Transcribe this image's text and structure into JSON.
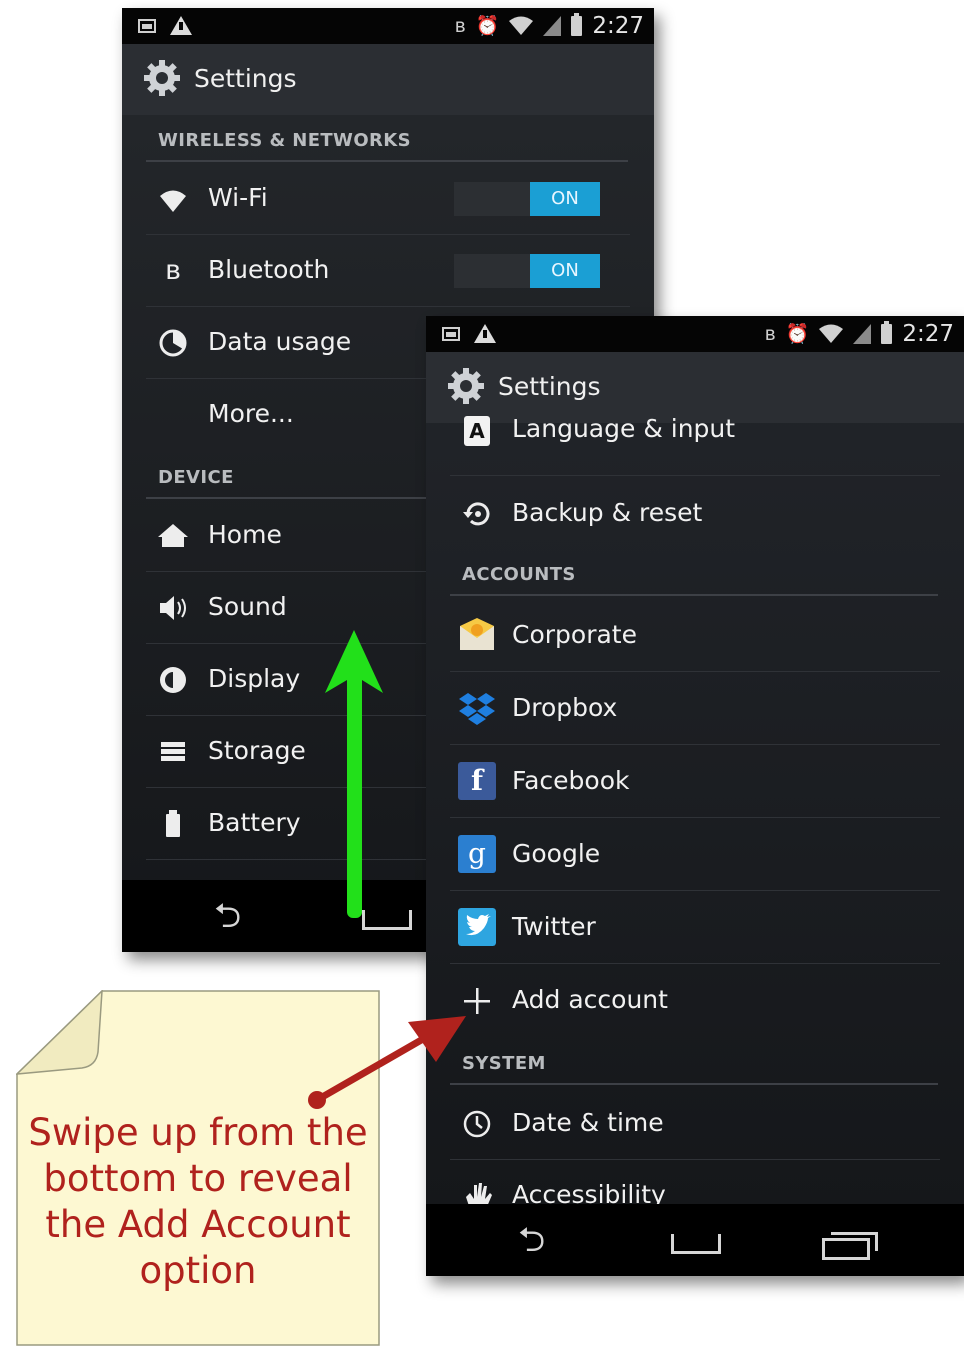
{
  "status": {
    "time": "2:27"
  },
  "back_screen": {
    "title": "Settings",
    "sections": {
      "wireless": "WIRELESS & NETWORKS",
      "device": "DEVICE"
    },
    "items": {
      "wifi": "Wi-Fi",
      "bluetooth": "Bluetooth",
      "data_usage": "Data usage",
      "more": "More...",
      "home": "Home",
      "sound": "Sound",
      "display": "Display",
      "storage": "Storage",
      "battery": "Battery"
    },
    "toggle_on": "ON"
  },
  "front_screen": {
    "title": "Settings",
    "sections": {
      "accounts": "ACCOUNTS",
      "system": "SYSTEM"
    },
    "items": {
      "language": "Language & input",
      "backup": "Backup & reset",
      "corporate": "Corporate",
      "dropbox": "Dropbox",
      "facebook": "Facebook",
      "google": "Google",
      "twitter": "Twitter",
      "add_account": "Add account",
      "date_time": "Date & time",
      "accessibility": "Accessibility"
    }
  },
  "note": {
    "line1": "Swipe up from the",
    "line2": "bottom to reveal",
    "line3": "the Add Account",
    "line4": "option"
  },
  "colors": {
    "toggle_on": "#1b9fd4",
    "swipe_arrow": "#22e01a",
    "pointer_arrow": "#b0221d",
    "note_bg": "#fdf8d2"
  }
}
